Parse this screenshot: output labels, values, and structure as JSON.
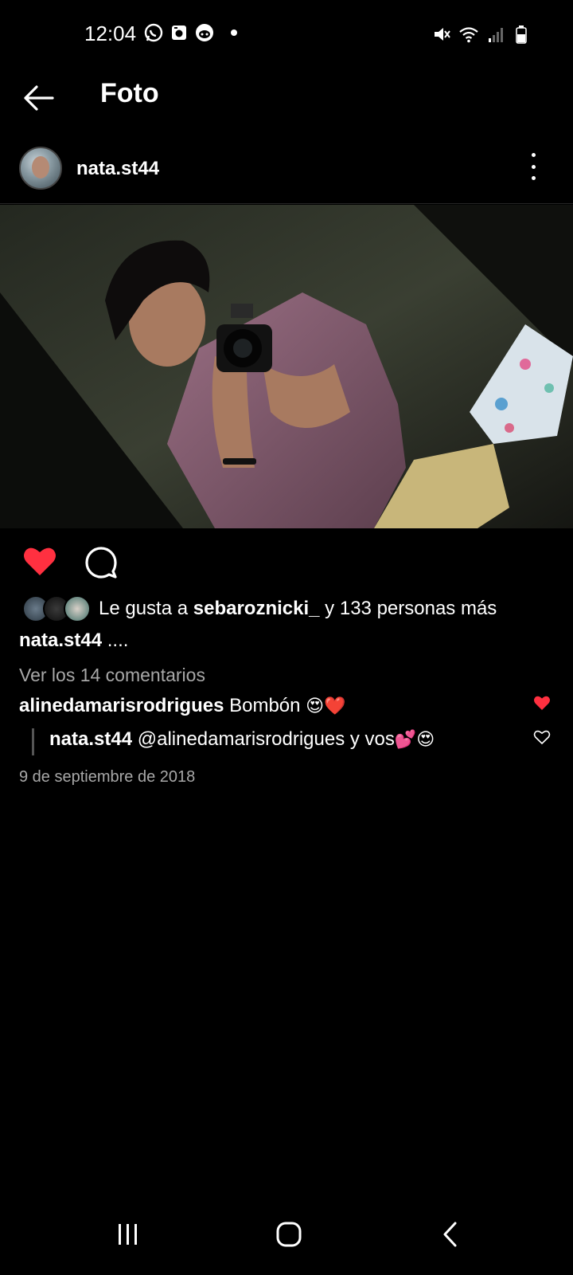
{
  "status_bar": {
    "time": "12:04",
    "left_icons": [
      "whatsapp-icon",
      "camera-app-icon",
      "reddit-icon"
    ],
    "right_icons": [
      "mute-icon",
      "wifi-icon",
      "signal-icon",
      "battery-icon"
    ]
  },
  "header": {
    "title": "Foto"
  },
  "post": {
    "username": "nata.st44",
    "liked": true,
    "likes_prefix": "Le gusta a ",
    "likes_user": "sebaroznicki_",
    "likes_suffix": " y 133 personas más",
    "caption_user": "nata.st44",
    "caption_text": " ....",
    "view_comments": "Ver los 14 comentarios",
    "comments": [
      {
        "user": "alinedamarisrodrigues",
        "text": " Bombón ",
        "emoji": "😍❤️",
        "liked": true
      },
      {
        "user": "nata.st44",
        "text": " @alinedamarisrodrigues y vos",
        "emoji": "💕😍",
        "liked": false
      }
    ],
    "date": "9 de septiembre de 2018"
  },
  "colors": {
    "like_red": "#ff3040",
    "muted_text": "#a8a8a8",
    "background": "#000000"
  }
}
